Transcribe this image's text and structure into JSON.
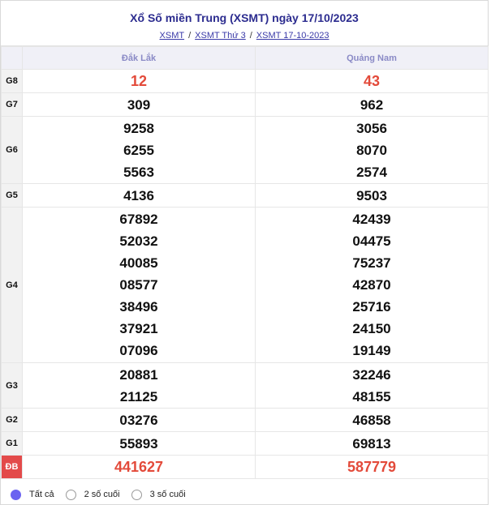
{
  "header": {
    "title": "Xổ Số miền Trung (XSMT) ngày 17/10/2023",
    "breadcrumbs": [
      "XSMT",
      "XSMT Thứ 3",
      "XSMT 17-10-2023"
    ],
    "separator": "/"
  },
  "provinces": [
    "Đắk Lắk",
    "Quảng Nam"
  ],
  "prizes": [
    {
      "label": "G8",
      "col1": [
        "12"
      ],
      "col2": [
        "43"
      ]
    },
    {
      "label": "G7",
      "col1": [
        "309"
      ],
      "col2": [
        "962"
      ]
    },
    {
      "label": "G6",
      "col1": [
        "9258",
        "6255",
        "5563"
      ],
      "col2": [
        "3056",
        "8070",
        "2574"
      ]
    },
    {
      "label": "G5",
      "col1": [
        "4136"
      ],
      "col2": [
        "9503"
      ]
    },
    {
      "label": "G4",
      "col1": [
        "67892",
        "52032",
        "40085",
        "08577",
        "38496",
        "37921",
        "07096"
      ],
      "col2": [
        "42439",
        "04475",
        "75237",
        "42870",
        "25716",
        "24150",
        "19149"
      ]
    },
    {
      "label": "G3",
      "col1": [
        "20881",
        "21125"
      ],
      "col2": [
        "32246",
        "48155"
      ]
    },
    {
      "label": "G2",
      "col1": [
        "03276"
      ],
      "col2": [
        "46858"
      ]
    },
    {
      "label": "G1",
      "col1": [
        "55893"
      ],
      "col2": [
        "69813"
      ]
    },
    {
      "label": "ĐB",
      "col1": [
        "441627"
      ],
      "col2": [
        "587779"
      ]
    }
  ],
  "filter": {
    "options": [
      "Tất cả",
      "2 số cuối",
      "3 số cuối"
    ],
    "selected": "Tất cả"
  },
  "colors": {
    "accent": "#6b63f0",
    "special_prize": "#e34a3a",
    "title": "#2c2c8f"
  }
}
